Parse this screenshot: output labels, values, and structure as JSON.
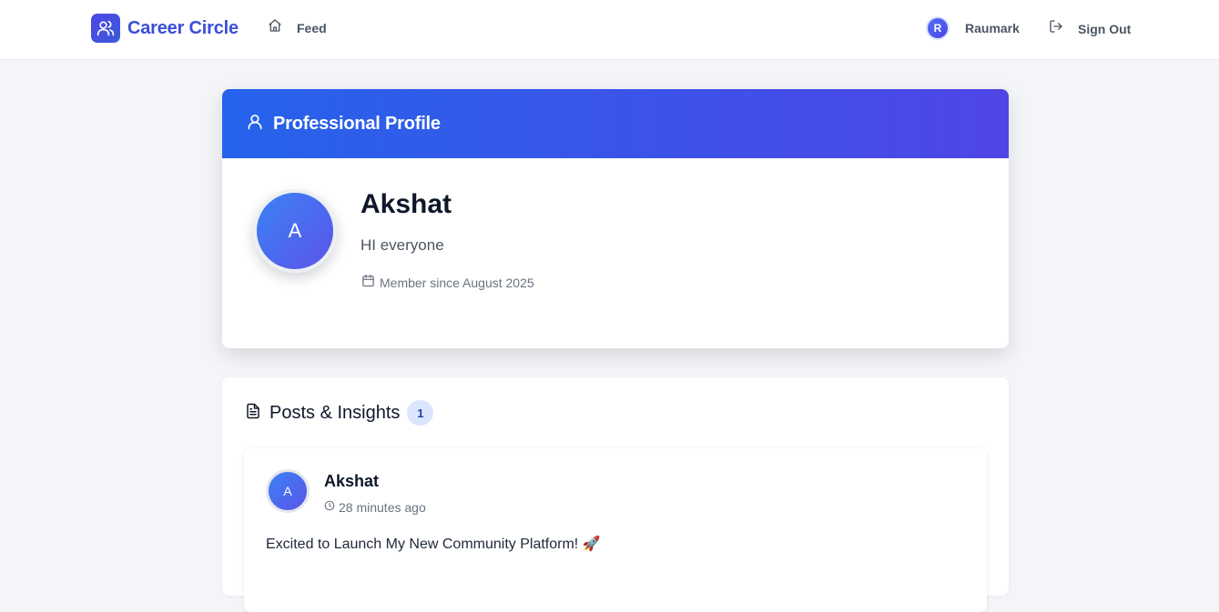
{
  "header": {
    "brand_name": "Career Circle",
    "brand_icon": "users-icon",
    "nav": {
      "feed_label": "Feed",
      "feed_icon": "home-icon"
    },
    "user": {
      "initial": "R",
      "name": "Raumark"
    },
    "signout": {
      "label": "Sign Out",
      "icon": "log-out-icon"
    }
  },
  "profile": {
    "header_title": "Professional Profile",
    "header_icon": "user-icon",
    "avatar_initial": "A",
    "name": "Akshat",
    "bio": "HI everyone",
    "member_since": "Member since August 2025",
    "member_icon": "calendar-icon"
  },
  "posts": {
    "title": "Posts & Insights",
    "title_icon": "document-icon",
    "count": "1",
    "items": [
      {
        "avatar_initial": "A",
        "author": "Akshat",
        "time": "28 minutes ago",
        "time_icon": "clock-icon",
        "content": "Excited to Launch My New Community Platform! 🚀"
      }
    ]
  },
  "colors": {
    "brand": "#3b4ed8",
    "header_gradient_start": "#2563eb",
    "header_gradient_end": "#4f46e5",
    "badge_bg": "#dbe6fe",
    "page_bg": "#f4f5f8"
  }
}
